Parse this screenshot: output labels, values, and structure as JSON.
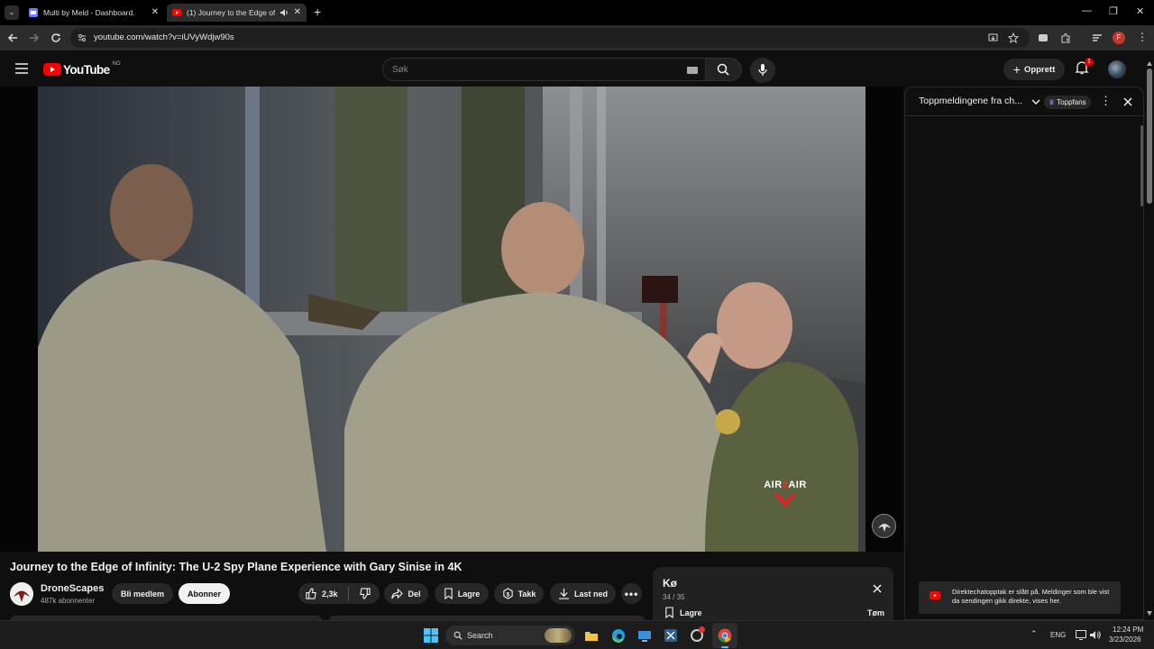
{
  "browser": {
    "tabs": [
      {
        "title": "Multi by Meld - Dashboard."
      },
      {
        "title": "(1) Journey to the Edge of I"
      }
    ],
    "url": "youtube.com/watch?v=iUVyWdjw90s",
    "profile_initial": "F"
  },
  "masthead": {
    "logo_text": "YouTube",
    "country_code": "NO",
    "search_placeholder": "Søk",
    "create_label": "Opprett",
    "notification_count": "1"
  },
  "video": {
    "title": "Journey to the Edge of Infinity: The U-2 Spy Plane Experience with Gary Sinise in 4K",
    "watermark_line1": "AIR",
    "watermark_line2": "2",
    "watermark_line3": "AIR"
  },
  "channel": {
    "name": "DroneScapes",
    "subscribers": "487k abonnenter",
    "join_label": "Bli medlem",
    "subscribe_label": "Abonner"
  },
  "actions": {
    "like_count": "2,3k",
    "share_label": "Del",
    "save_label": "Lagre",
    "thanks_label": "Takk",
    "download_label": "Last ned"
  },
  "chat": {
    "header_title": "Toppmeldingene fra ch...",
    "toppfans_label": "Toppfans",
    "toast_text": "Direktechatopptak er slått på. Meldinger som ble vist da sendingen gikk direkte, vises her."
  },
  "queue": {
    "title": "Kø",
    "position": "34 / 35",
    "save_label": "Lagre",
    "clear_label": "Tøm"
  },
  "taskbar": {
    "search_label": "Search",
    "language": "ENG",
    "time": "12:24 PM",
    "date": "3/23/2026"
  },
  "colors": {
    "youtube_red": "#ff0000",
    "background": "#0f0f0f",
    "surface": "#272727",
    "subscribe_bg": "#f1f1f1"
  }
}
